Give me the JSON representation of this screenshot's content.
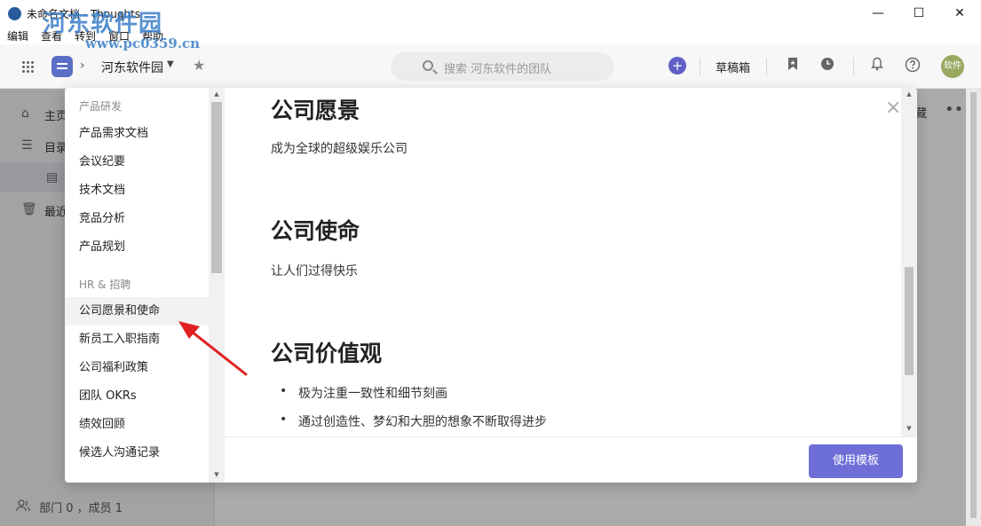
{
  "window": {
    "title": "未命名文档 - Thoughts",
    "controls": {
      "minimize": "—",
      "maximize": "☐",
      "close": "✕"
    }
  },
  "watermark": {
    "text": "河东软件园",
    "url": "www.pc0359.cn"
  },
  "menu": [
    "编辑",
    "查看",
    "转到",
    "窗口",
    "帮助"
  ],
  "header": {
    "team_name": "河东软件园",
    "crumb_sep": "›",
    "caret": "▼",
    "star": "★",
    "search_placeholder": "搜索 河东软件的团队",
    "plus": "+",
    "drafts": "草稿箱",
    "avatar": "软件"
  },
  "sidebar": {
    "items": [
      {
        "icon": "⌂",
        "label": "主页"
      },
      {
        "icon": "☰",
        "label": "目录"
      },
      {
        "icon": "▤",
        "label": ""
      },
      {
        "icon": "🗑",
        "label": "最近"
      }
    ],
    "footer": "部门 0 ，成员 1"
  },
  "background": {
    "more": "•••",
    "partial_text": "藏"
  },
  "templates": {
    "groups": [
      {
        "title": "产品研发",
        "items": [
          "产品需求文档",
          "会议纪要",
          "技术文档",
          "竞品分析",
          "产品规划"
        ]
      },
      {
        "title": "HR & 招聘",
        "items": [
          "公司愿景和使命",
          "新员工入职指南",
          "公司福利政策",
          "团队 OKRs",
          "绩效回顾",
          "候选人沟通记录"
        ]
      }
    ],
    "active": "公司愿景和使命"
  },
  "preview": {
    "sections": [
      {
        "heading": "公司愿景",
        "text": "成为全球的超级娱乐公司"
      },
      {
        "heading": "公司使命",
        "text": "让人们过得快乐"
      },
      {
        "heading": "公司价值观",
        "bullets": [
          "极为注重一致性和细节刻画",
          "通过创造性、梦幻和大胆的想象不断取得进步"
        ]
      }
    ],
    "close": "×",
    "bullet": "•"
  },
  "footer": {
    "use_template": "使用模板"
  },
  "colors": {
    "accent": "#6d6fd6",
    "annotation": "#e02020"
  }
}
